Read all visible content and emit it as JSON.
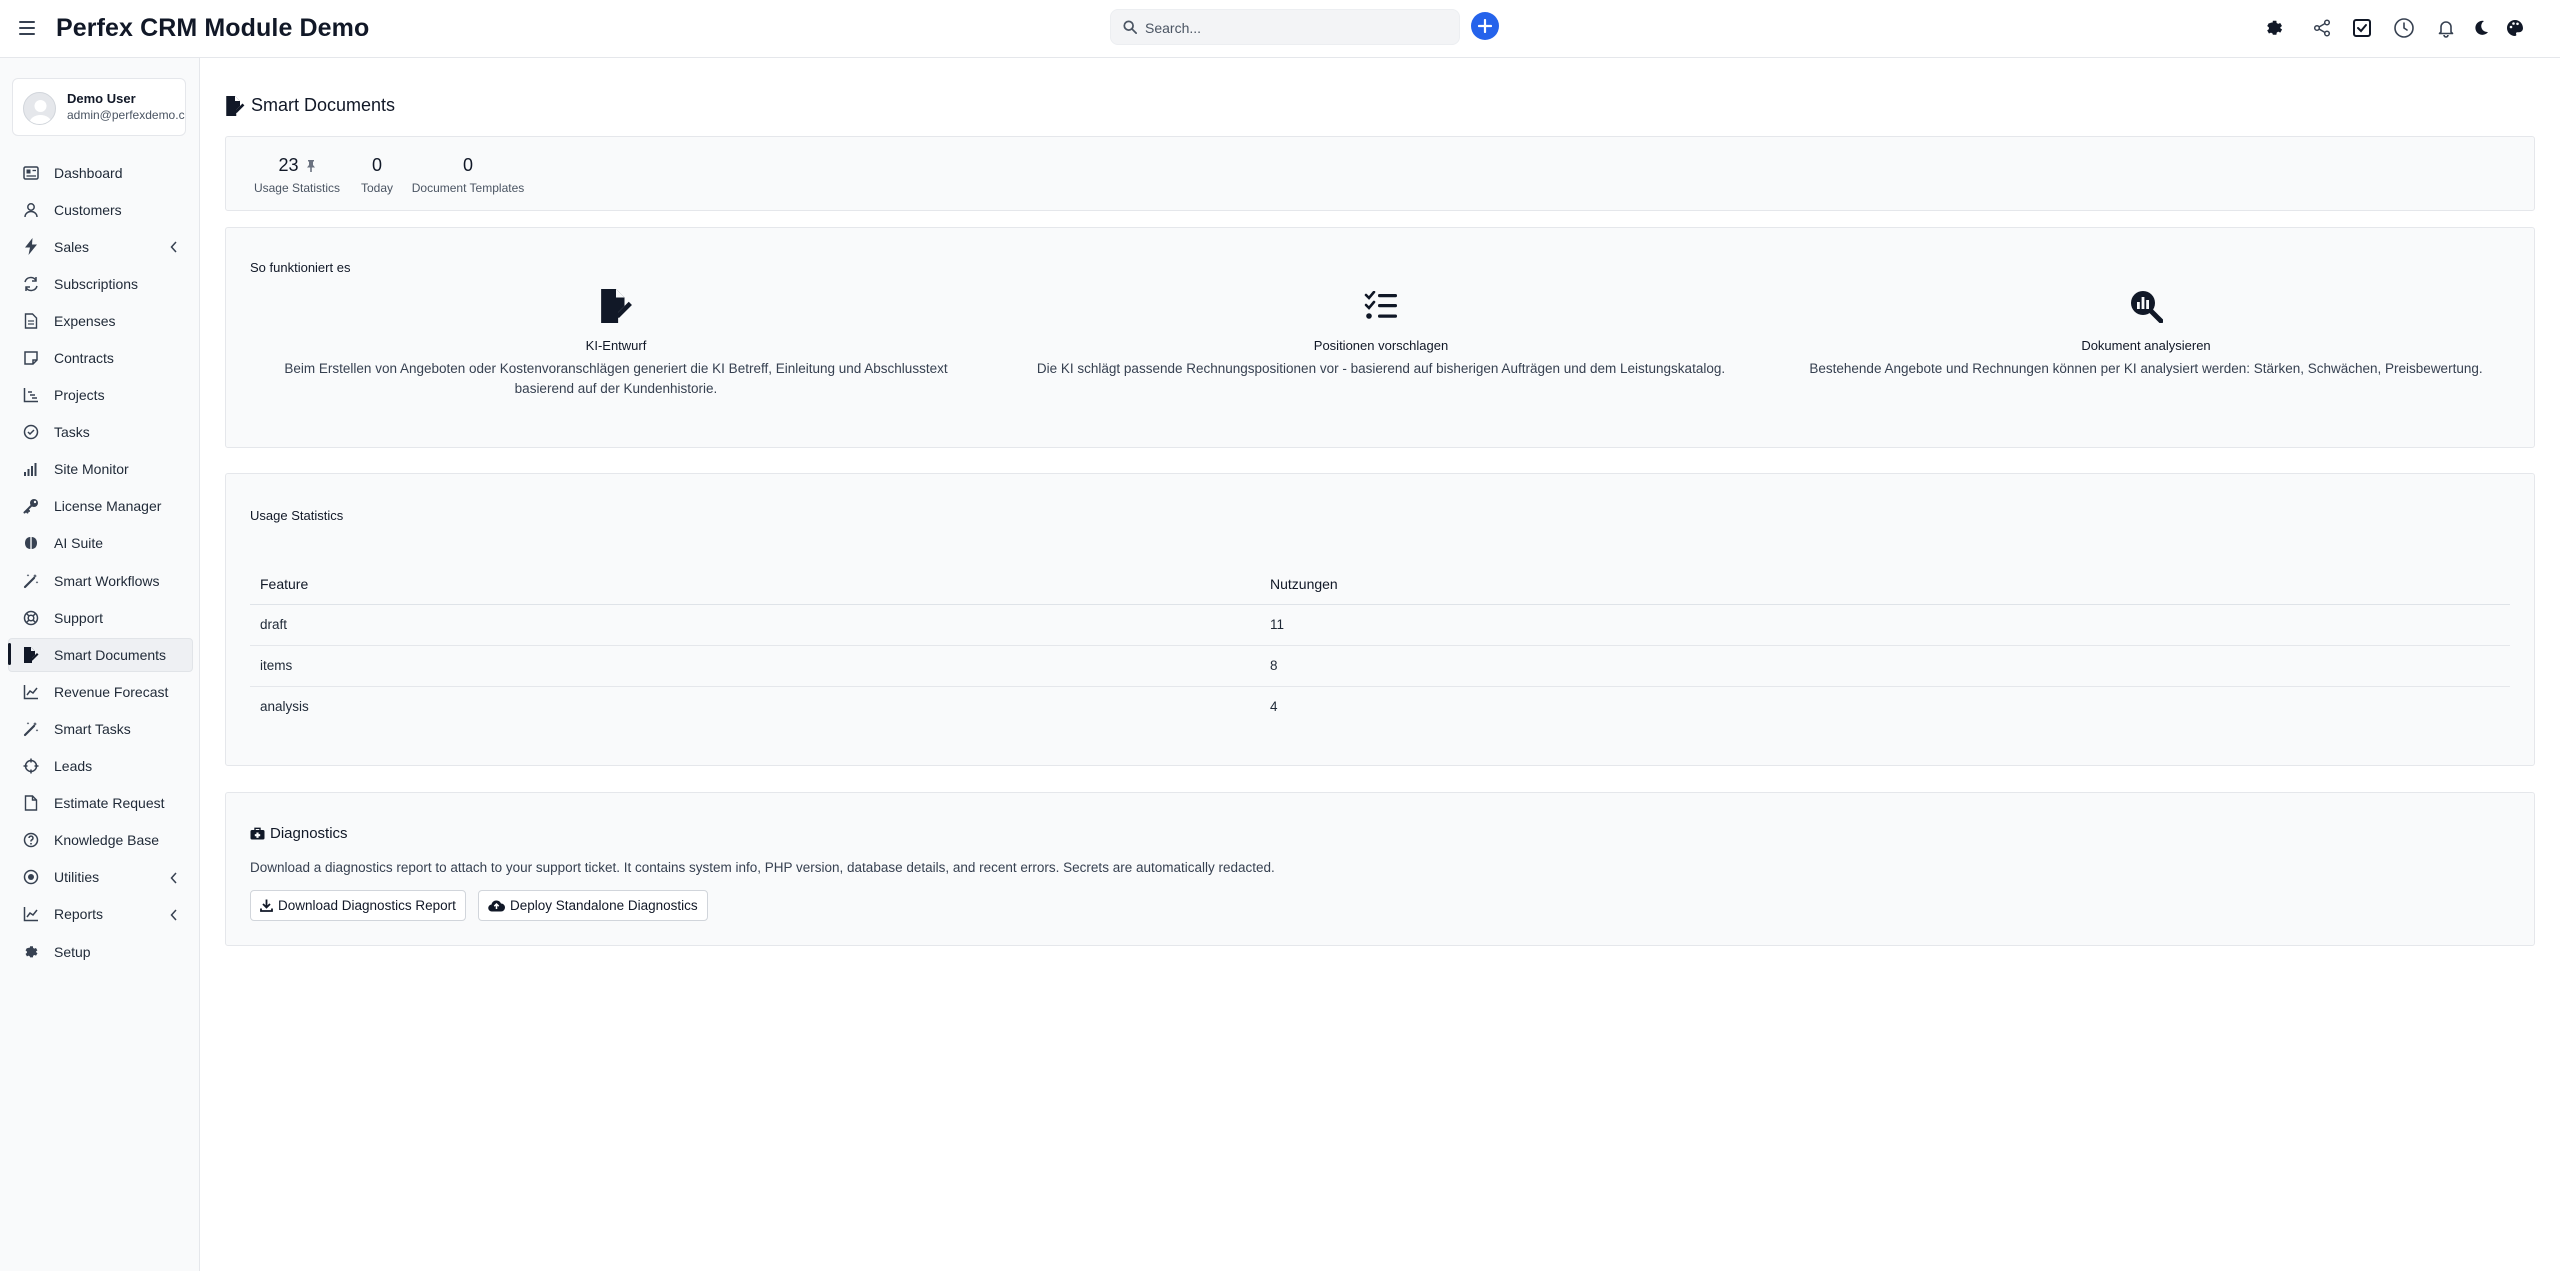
{
  "header": {
    "title": "Perfex CRM Module Demo",
    "search_placeholder": "Search..."
  },
  "user": {
    "name": "Demo User",
    "email": "admin@perfexdemo.c..."
  },
  "sidebar": {
    "items": [
      {
        "label": "Dashboard",
        "icon": "dashboard-icon"
      },
      {
        "label": "Customers",
        "icon": "user-icon"
      },
      {
        "label": "Sales",
        "icon": "bolt-icon",
        "has_submenu": true
      },
      {
        "label": "Subscriptions",
        "icon": "refresh-icon"
      },
      {
        "label": "Expenses",
        "icon": "document-icon"
      },
      {
        "label": "Contracts",
        "icon": "note-icon"
      },
      {
        "label": "Projects",
        "icon": "chart-icon"
      },
      {
        "label": "Tasks",
        "icon": "check-circle-icon"
      },
      {
        "label": "Site Monitor",
        "icon": "signal-icon"
      },
      {
        "label": "License Manager",
        "icon": "key-icon"
      },
      {
        "label": "AI Suite",
        "icon": "brain-icon"
      },
      {
        "label": "Smart Workflows",
        "icon": "magic-wand-icon"
      },
      {
        "label": "Support",
        "icon": "lifebuoy-icon"
      },
      {
        "label": "Smart Documents",
        "icon": "file-signature-icon",
        "active": true
      },
      {
        "label": "Revenue Forecast",
        "icon": "line-chart-icon"
      },
      {
        "label": "Smart Tasks",
        "icon": "magic-wand-icon"
      },
      {
        "label": "Leads",
        "icon": "crosshair-icon"
      },
      {
        "label": "Estimate Request",
        "icon": "file-icon"
      },
      {
        "label": "Knowledge Base",
        "icon": "question-circle-icon"
      },
      {
        "label": "Utilities",
        "icon": "dot-circle-icon",
        "has_submenu": true
      },
      {
        "label": "Reports",
        "icon": "line-chart-icon",
        "has_submenu": true
      },
      {
        "label": "Setup",
        "icon": "gear-icon"
      }
    ]
  },
  "page": {
    "title": "Smart Documents"
  },
  "stats": [
    {
      "value": "23",
      "label": "Usage Statistics",
      "pinned": true
    },
    {
      "value": "0",
      "label": "Today"
    },
    {
      "value": "0",
      "label": "Document Templates"
    }
  ],
  "how_it_works": {
    "title": "So funktioniert es",
    "features": [
      {
        "icon": "file-signature-icon",
        "title": "KI-Entwurf",
        "description": "Beim Erstellen von Angeboten oder Kostenvoranschlägen generiert die KI Betreff, Einleitung und Abschlusstext basierend auf der Kundenhistorie."
      },
      {
        "icon": "list-check-icon",
        "title": "Positionen vorschlagen",
        "description": "Die KI schlägt passende Rechnungspositionen vor - basierend auf bisherigen Aufträgen und dem Leistungskatalog."
      },
      {
        "icon": "magnifier-chart-icon",
        "title": "Dokument analysieren",
        "description": "Bestehende Angebote und Rechnungen können per KI analysiert werden: Stärken, Schwächen, Preisbewertung."
      }
    ]
  },
  "usage": {
    "title": "Usage Statistics",
    "columns": [
      "Feature",
      "Nutzungen"
    ],
    "rows": [
      [
        "draft",
        "11"
      ],
      [
        "items",
        "8"
      ],
      [
        "analysis",
        "4"
      ]
    ]
  },
  "diagnostics": {
    "title": "Diagnostics",
    "description": "Download a diagnostics report to attach to your support ticket. It contains system info, PHP version, database details, and recent errors. Secrets are automatically redacted.",
    "download_label": "Download Diagnostics Report",
    "deploy_label": "Deploy Standalone Diagnostics"
  },
  "colors": {
    "accent": "#2563eb",
    "sidebar_bg": "#f9fafb",
    "card_bg": "#f9fafb"
  }
}
